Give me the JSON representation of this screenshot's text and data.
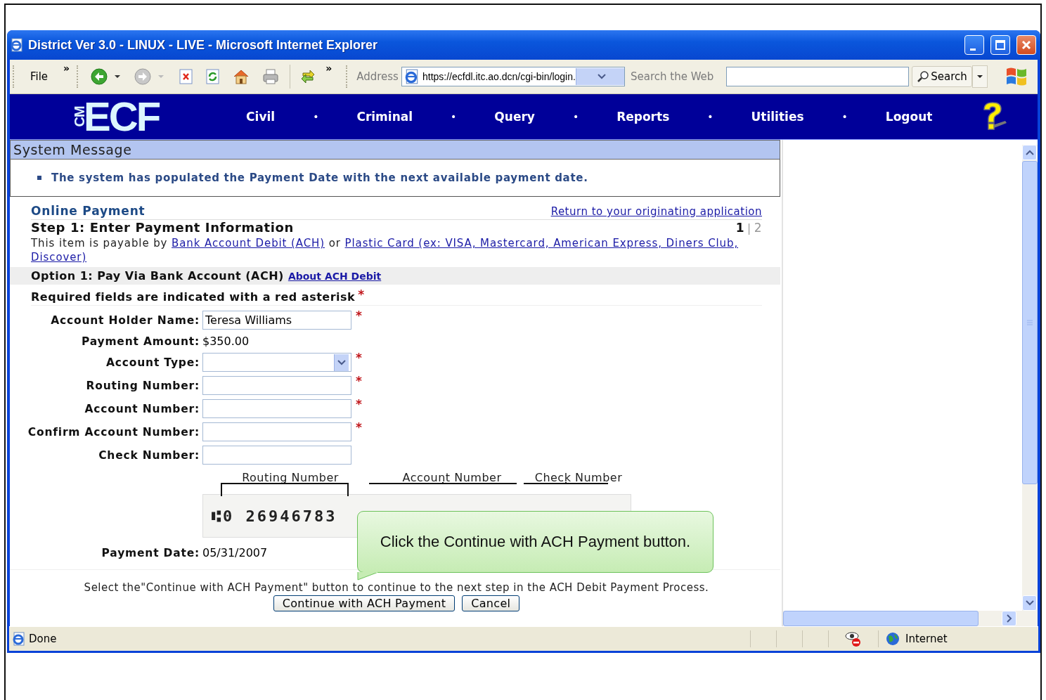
{
  "window": {
    "title": "District Ver 3.0 - LINUX - LIVE - Microsoft Internet Explorer"
  },
  "toolbar": {
    "menu": "File",
    "chevron_1": "»",
    "chevron_2": "»",
    "address_label": "Address",
    "address": "https://ecfdl.itc.ao.dcn/cgi-bin/login.",
    "search_label": "Search the Web",
    "search_button": "Search"
  },
  "nav": {
    "logo_small": "CM",
    "logo": "ECF",
    "items": [
      {
        "label": "Civil",
        "separator": "•"
      },
      {
        "label": "Criminal",
        "separator": "•"
      },
      {
        "label": "Query",
        "separator": "•"
      },
      {
        "label": "Reports",
        "separator": "•"
      },
      {
        "label": "Utilities",
        "separator": "•"
      },
      {
        "label": "Logout"
      }
    ]
  },
  "system_message": {
    "title": "System Message",
    "messages": [
      "The system has populated the Payment Date with the next available payment date."
    ]
  },
  "payment": {
    "heading": "Online Payment",
    "return_link": "Return to your originating application",
    "step_title": "Step 1: Enter Payment Information",
    "steps": [
      {
        "label": "1",
        "selected": true
      },
      {
        "label": "2",
        "selected": false
      }
    ],
    "step_separator": "|",
    "intro": {
      "text_before": "This item is payable by",
      "link_1": "Bank Account Debit (ACH)",
      "text_middle": "or",
      "link_2": [
        "Plastic Card (ex: VISA, Mastercard, American Express, Diners Club,",
        "Discover)"
      ]
    },
    "option_title": "Option 1: Pay Via Bank Account (ACH)",
    "option_link": "About ACH Debit",
    "required_note": "Required fields are indicated with a red asterisk",
    "required_note_mark": "*",
    "fields": [
      {
        "kind": "text",
        "label": "Account Holder Name:",
        "value": "Teresa Williams",
        "marker": "*"
      },
      {
        "kind": "display",
        "label": "Payment Amount:",
        "value": "$350.00"
      },
      {
        "kind": "select",
        "label": "Account Type:",
        "marker": "*"
      },
      {
        "kind": "text",
        "label": "Routing Number:",
        "marker": "*"
      },
      {
        "kind": "text",
        "label": "Account Number:",
        "marker": "*"
      },
      {
        "kind": "text",
        "label": "Confirm Account Number:",
        "marker": "*"
      },
      {
        "kind": "text",
        "label": "Check Number:"
      }
    ],
    "check": {
      "labels": [
        "Routing Number",
        "Account Number",
        "Check Number"
      ],
      "micr": "⑆0 26946783"
    },
    "payment_date": {
      "label": "Payment Date:",
      "value": "05/31/2007"
    },
    "instruction": "Select the\"Continue with ACH Payment\" button to continue to the next step in the ACH Debit Payment Process.",
    "buttons": [
      "Continue with ACH Payment",
      "Cancel"
    ]
  },
  "callout": {
    "text": "Click the Continue with ACH Payment button."
  },
  "status_bar": {
    "text": "Done",
    "zone": "Internet"
  }
}
